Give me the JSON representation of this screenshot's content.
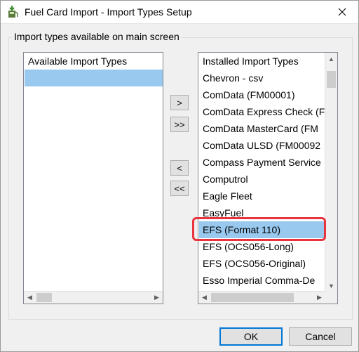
{
  "window": {
    "title": "Fuel Card Import - Import Types Setup",
    "app_icon": "fuel-pump-download-icon",
    "close_icon": "close-icon"
  },
  "group": {
    "legend": "Import types available on main screen"
  },
  "available": {
    "header": "Available Import Types",
    "items": [
      ""
    ]
  },
  "installed": {
    "header": "Installed Import Types",
    "items": [
      "Chevron - csv",
      "ComData (FM00001)",
      "ComData Express Check (FM",
      "ComData MasterCard (FM",
      "ComData ULSD (FM00092",
      "Compass Payment Service",
      "Computrol",
      "Eagle Fleet",
      "EasyFuel",
      "EFS (Format 110)",
      "EFS (OCS056-Long)",
      "EFS (OCS056-Original)",
      "Esso Imperial Comma-De"
    ],
    "selected_item": "EFS (Format 110)"
  },
  "move_buttons": {
    "add_one": ">",
    "add_all": ">>",
    "remove_one": "<",
    "remove_all": "<<"
  },
  "dialog_buttons": {
    "ok": "OK",
    "cancel": "Cancel"
  },
  "colors": {
    "selection": "#99c9ef",
    "highlight_border": "#e8343f",
    "default_button_border": "#0078d7"
  }
}
